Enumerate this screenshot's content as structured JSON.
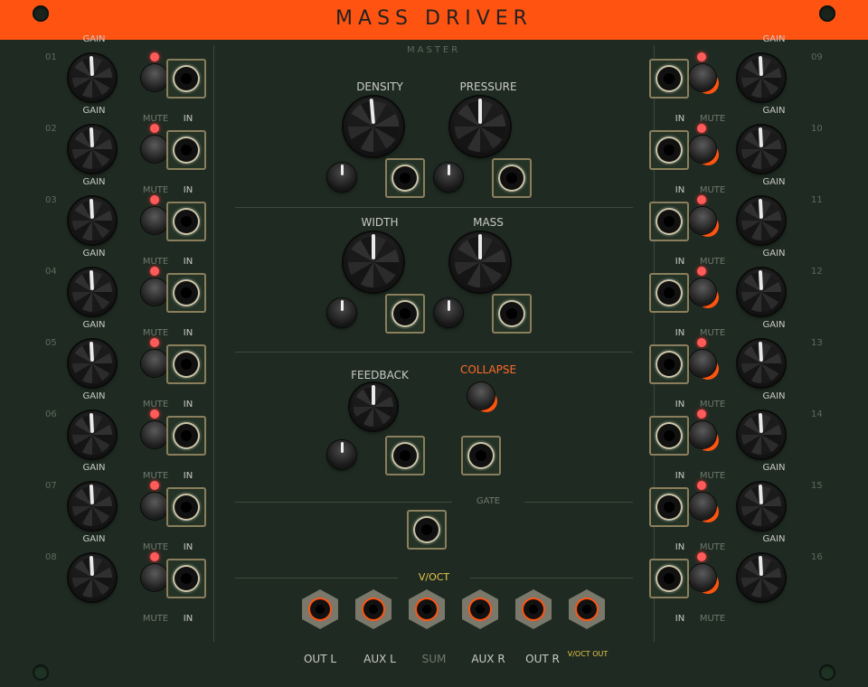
{
  "module": {
    "title": "MASS DRIVER",
    "accent_color": "#ff5411",
    "panel_color": "#1f2b22"
  },
  "channels_left": [
    {
      "num": "01",
      "gain_label": "GAIN",
      "mute_label": "MUTE",
      "in_label": "IN"
    },
    {
      "num": "02",
      "gain_label": "GAIN",
      "mute_label": "MUTE",
      "in_label": "IN"
    },
    {
      "num": "03",
      "gain_label": "GAIN",
      "mute_label": "MUTE",
      "in_label": "IN"
    },
    {
      "num": "04",
      "gain_label": "GAIN",
      "mute_label": "MUTE",
      "in_label": "IN"
    },
    {
      "num": "05",
      "gain_label": "GAIN",
      "mute_label": "MUTE",
      "in_label": "IN"
    },
    {
      "num": "06",
      "gain_label": "GAIN",
      "mute_label": "MUTE",
      "in_label": "IN"
    },
    {
      "num": "07",
      "gain_label": "GAIN",
      "mute_label": "MUTE",
      "in_label": "IN"
    },
    {
      "num": "08",
      "gain_label": "GAIN",
      "mute_label": "MUTE",
      "in_label": "IN"
    }
  ],
  "channels_right": [
    {
      "num": "09",
      "gain_label": "GAIN",
      "mute_label": "MUTE",
      "in_label": "IN"
    },
    {
      "num": "10",
      "gain_label": "GAIN",
      "mute_label": "MUTE",
      "in_label": "IN"
    },
    {
      "num": "11",
      "gain_label": "GAIN",
      "mute_label": "MUTE",
      "in_label": "IN"
    },
    {
      "num": "12",
      "gain_label": "GAIN",
      "mute_label": "MUTE",
      "in_label": "IN"
    },
    {
      "num": "13",
      "gain_label": "GAIN",
      "mute_label": "MUTE",
      "in_label": "IN"
    },
    {
      "num": "14",
      "gain_label": "GAIN",
      "mute_label": "MUTE",
      "in_label": "IN"
    },
    {
      "num": "15",
      "gain_label": "GAIN",
      "mute_label": "MUTE",
      "in_label": "IN"
    },
    {
      "num": "16",
      "gain_label": "GAIN",
      "mute_label": "MUTE",
      "in_label": "IN"
    }
  ],
  "master": {
    "section_label": "MASTER",
    "density_label": "DENSITY",
    "pressure_label": "PRESSURE",
    "width_label": "WIDTH",
    "mass_label": "MASS",
    "feedback_label": "FEEDBACK",
    "collapse_label": "COLLAPSE",
    "gate_label": "GATE",
    "voct_label": "V/OCT"
  },
  "outputs": {
    "out_l": "OUT L",
    "aux_l": "AUX L",
    "sum": "SUM",
    "aux_r": "AUX R",
    "out_r": "OUT R",
    "voct_out": "V/OCT OUT"
  }
}
